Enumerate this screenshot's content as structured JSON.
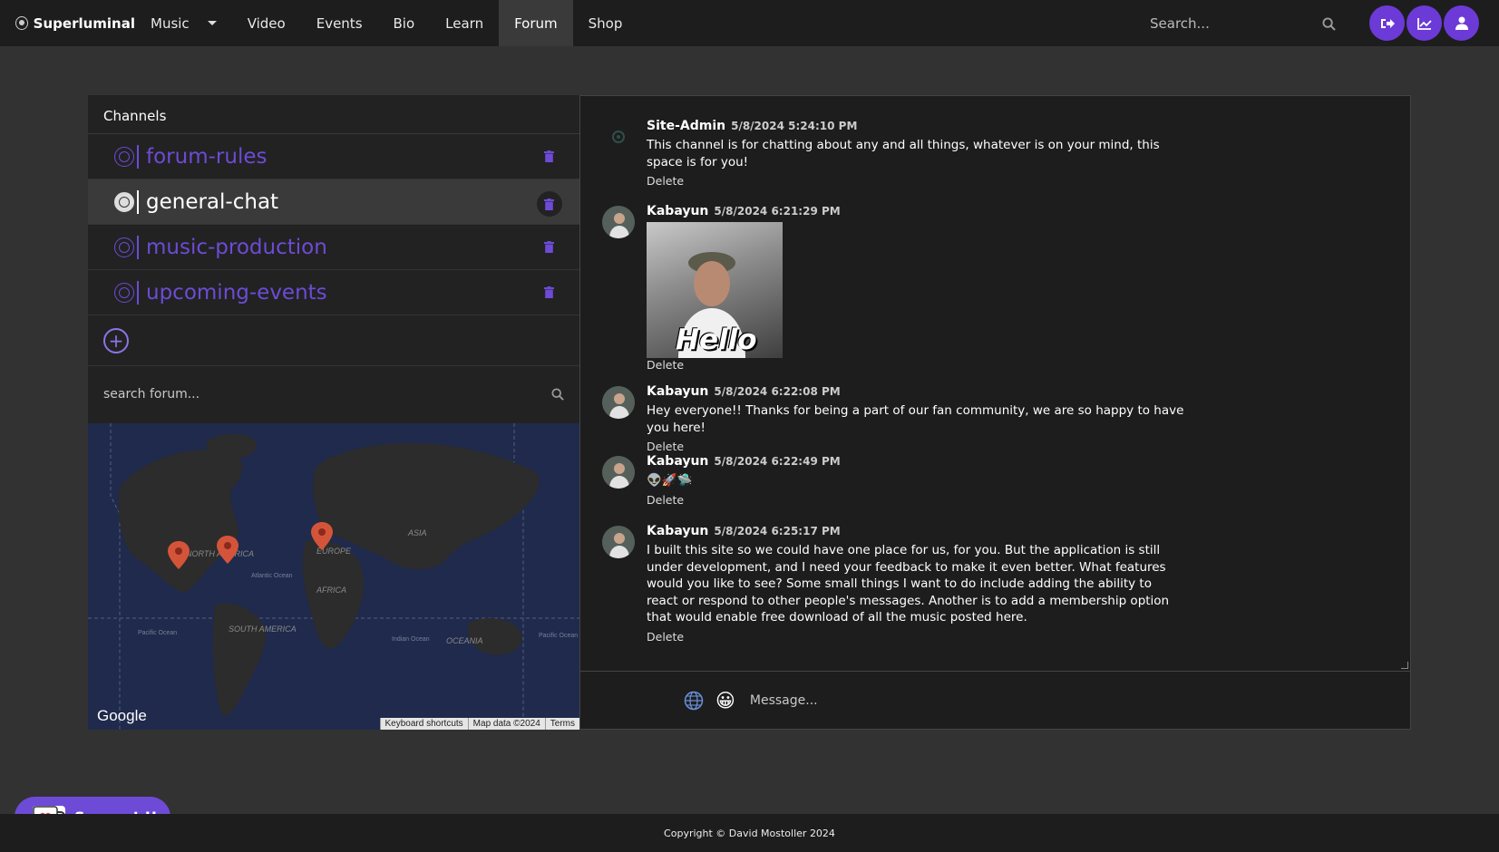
{
  "colors": {
    "accent": "#6d4bd6",
    "navbar": "#1d1d1d",
    "page_bg": "#323232",
    "pin": "#d4543a"
  },
  "nav": {
    "brand": "Superluminal",
    "items": [
      {
        "label": "Music"
      },
      {
        "label": "Video"
      },
      {
        "label": "Events"
      },
      {
        "label": "Bio"
      },
      {
        "label": "Learn"
      },
      {
        "label": "Forum",
        "active": true
      },
      {
        "label": "Shop"
      }
    ],
    "search_placeholder": "Search...",
    "icons": [
      "logout-icon",
      "chart-icon",
      "user-icon"
    ]
  },
  "channels": {
    "header": "Channels",
    "items": [
      {
        "name": "forum-rules"
      },
      {
        "name": "general-chat",
        "active": true
      },
      {
        "name": "music-production"
      },
      {
        "name": "upcoming-events"
      }
    ],
    "search_placeholder": "search forum..."
  },
  "map": {
    "provider": "Google",
    "labels": [
      "NORTH AMERICA",
      "EUROPE",
      "ASIA",
      "AFRICA",
      "SOUTH AMERICA",
      "OCEANIA",
      "Atlantic Ocean",
      "Pacific Ocean",
      "Indian Ocean",
      "Pacific Ocean"
    ],
    "attribution": [
      "Keyboard shortcuts",
      "Map data ©2024",
      "Terms"
    ]
  },
  "messages": [
    {
      "user": "Site-Admin",
      "time": "5/8/2024 5:24:10 PM",
      "text": "This channel is for chatting about any and all things, whatever is on your mind, this space is for you!",
      "delete": "Delete"
    },
    {
      "user": "Kabayun",
      "time": "5/8/2024 6:21:29 PM",
      "image_text": "Hello",
      "delete": "Delete"
    },
    {
      "user": "Kabayun",
      "time": "5/8/2024 6:22:08 PM",
      "text": "Hey everyone!! Thanks for being a part of our fan community, we are so happy to have you here!",
      "delete": "Delete"
    },
    {
      "user": "Kabayun",
      "time": "5/8/2024 6:22:49 PM",
      "text": "👽🚀🛸",
      "delete": "Delete"
    },
    {
      "user": "Kabayun",
      "time": "5/8/2024 6:25:17 PM",
      "text": "I built this site so we could have one place for us, for you. But the application is still under development, and I need your feedback to make it even better. What features would you like to see? Some small things I want to do include adding the ability to react or respond to other people's messages. Another is to add a membership option that would enable free download of all the music posted here.",
      "delete": "Delete"
    }
  ],
  "composer": {
    "placeholder": "Message...",
    "emoji": "😀"
  },
  "support": {
    "label": "Support Us"
  },
  "footer": {
    "copyright": "Copyright © David Mostoller 2024"
  }
}
